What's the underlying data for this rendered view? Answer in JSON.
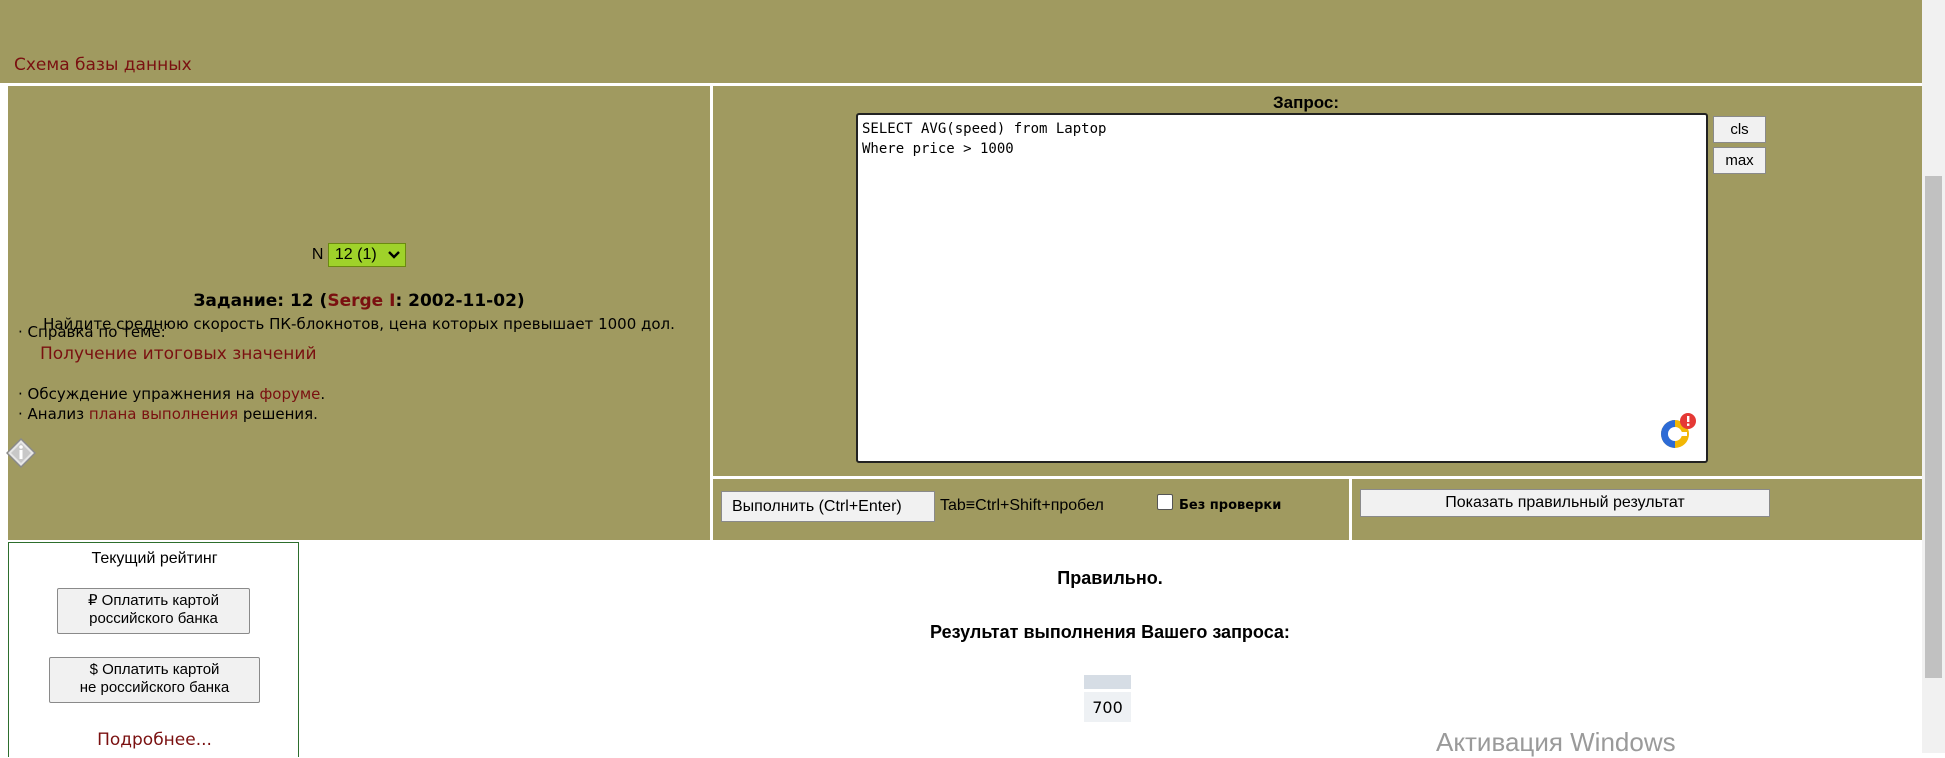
{
  "header": {
    "schema_link": "Схема базы данных"
  },
  "task": {
    "n_label": "N",
    "n_selected": "12 (1)",
    "title_prefix": "Задание: 12 (",
    "author": "Serge I",
    "title_suffix": ": 2002-11-02)",
    "text": "Найдите среднюю скорость ПК-блокнотов, цена которых превышает 1000 дол."
  },
  "info": {
    "help_prefix": "· Справка по теме:",
    "help_link": "Получение итоговых значений",
    "forum_prefix": "· Обсуждение упражнения на ",
    "forum_link": "форуме",
    "forum_suffix": ".",
    "plan_prefix": "· Анализ ",
    "plan_link": "плана выполнения",
    "plan_suffix": " решения."
  },
  "query": {
    "label": "Запрос:",
    "text": "SELECT AVG(speed) from Laptop\nWhere price > 1000",
    "cls_label": "cls",
    "max_label": "max"
  },
  "actions": {
    "execute_label": "Выполнить (Ctrl+Enter)",
    "tab_hint": "Tab≡Ctrl+Shift+пробел",
    "no_check_label": "Без проверки",
    "show_result_label": "Показать правильный результат"
  },
  "rating": {
    "title": "Текущий рейтинг",
    "pay_ru": "₽ Оплатить картой российского банка",
    "pay_ru_line1": "₽ Оплатить картой",
    "pay_ru_line2": "российского банка",
    "pay_foreign_line1": "$ Оплатить картой",
    "pay_foreign_line2": "не российского банка",
    "more_link": "Подробнее..."
  },
  "result": {
    "status": "Правильно.",
    "title": "Результат выполнения Вашего запроса:",
    "column_header": "",
    "value": "700"
  },
  "watermark": "Активация Windows",
  "colors": {
    "panel_bg": "#a09a60",
    "link": "#7a1010",
    "select_bg": "#9fd22a"
  }
}
